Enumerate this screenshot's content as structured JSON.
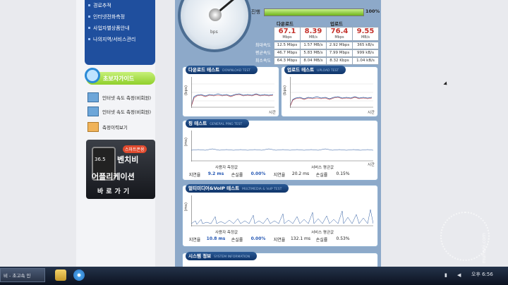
{
  "leftnav": {
    "items": [
      "경로추적",
      "인터넷전화측정",
      "사업자별상품안내",
      "나의지역/서비스관리"
    ]
  },
  "guide": {
    "title": "초보자가이드",
    "items": [
      "인터넷 속도 측정(비회원)",
      "인터넷 속도 측정(비회원)",
      "측정이력보기"
    ]
  },
  "app_ad": {
    "badge": "스마트폰용",
    "phone_value": "36.5",
    "line1": "벤치비",
    "line2": "어플리케이션",
    "line3": "바로가기"
  },
  "gauge": {
    "unit": "bps",
    "scale": "100M"
  },
  "progress": {
    "label": "진행",
    "percent": 100,
    "percent_text": "100%"
  },
  "stats": {
    "download_header": "다운로드",
    "upload_header": "업로드",
    "download": {
      "mbps": "67.1",
      "mbps_unit": "Mbps",
      "mbs": "8.39",
      "mbs_unit": "MB/s"
    },
    "upload": {
      "mbps": "76.4",
      "mbps_unit": "Mbps",
      "mbs": "9.55",
      "mbs_unit": "MB/s"
    },
    "row_labels": [
      "최대속도",
      "평균속도",
      "최소속도"
    ],
    "rows": [
      [
        "12.5 Mbps",
        "1.57 MB/s",
        "2.92 Mbps",
        "365 kB/s"
      ],
      [
        "46.7 Mbps",
        "5.83 MB/s",
        "7.99 Mbps",
        "999 kB/s"
      ],
      [
        "64.3 Mbps",
        "8.04 MB/s",
        "8.32 Kbps",
        "1.04 kB/s"
      ]
    ]
  },
  "download_test": {
    "title": "다운로드 테스트",
    "subtitle": "DOWNLOAD TEST",
    "ylabel": "(bps)",
    "xlabel": "시간"
  },
  "upload_test": {
    "title": "업로드 테스트",
    "subtitle": "UPLOAD TEST",
    "ylabel": "(bps)",
    "xlabel": "시간"
  },
  "ping_test": {
    "title": "핑 테스트",
    "subtitle": "GENERAL PING TEST",
    "ylabel": "(ms)",
    "xlabel": "시간",
    "user_header": "사용자 측정값",
    "server_header": "서버스 평균값",
    "labels": [
      "지연율",
      "손실률"
    ],
    "user": {
      "delay": "9.2 ms",
      "loss": "0.00%"
    },
    "server": {
      "delay": "20.2 ms",
      "loss": "0.15%"
    }
  },
  "multimedia_test": {
    "title": "멀티미디어&VoIP 테스트",
    "subtitle": "MULTIMEDIA & VoIP TEST",
    "ylabel": "(ms)",
    "user_header": "사용자 측정값",
    "server_header": "서비스 평균값",
    "labels": [
      "지연율",
      "손실률"
    ],
    "user": {
      "delay": "10.8 ms",
      "loss": "0.00%"
    },
    "server": {
      "delay": "132.1 ms",
      "loss": "0.53%"
    }
  },
  "system_info": {
    "title": "시스템 정보",
    "subtitle": "SYSTEM INFORMATION"
  },
  "taskbar": {
    "app_label": "비 - 초고속 인",
    "time": "오후 6:56"
  },
  "watermark": {
    "text": "muhani.com"
  }
}
